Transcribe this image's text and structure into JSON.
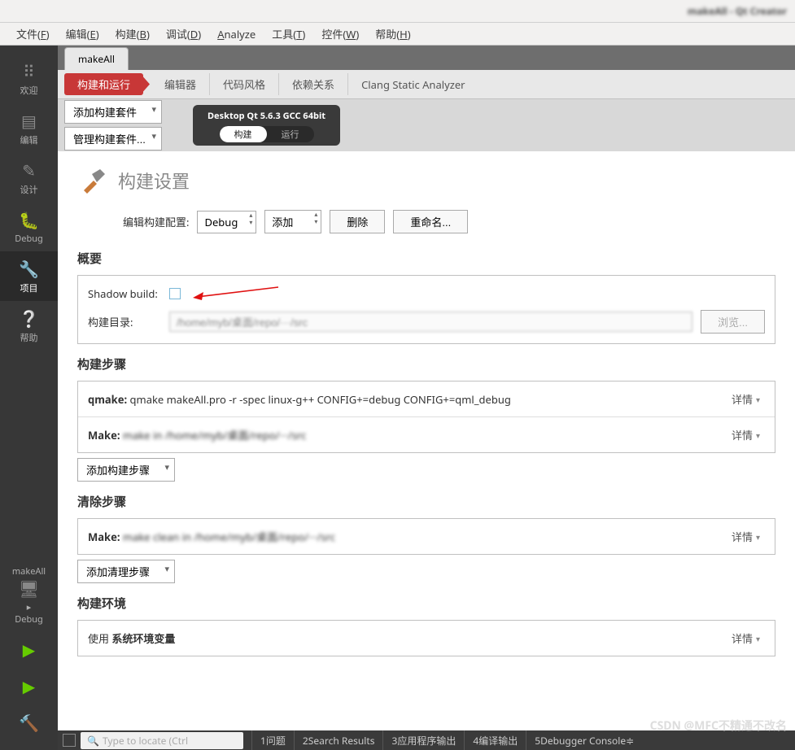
{
  "window_title": "makeAll - Qt Creator",
  "menu": {
    "file": "文件(F)",
    "edit": "编辑(E)",
    "build": "构建(B)",
    "debug": "调试(D)",
    "analyze": "Analyze",
    "tools": "工具(T)",
    "widgets": "控件(W)",
    "help": "帮助(H)"
  },
  "rail": {
    "welcome": "欢迎",
    "edit": "编辑",
    "design": "设计",
    "debug": "Debug",
    "projects": "项目",
    "help": "帮助",
    "project_name": "makeAll",
    "run_target": "Debug"
  },
  "tab": "makeAll",
  "subtabs": {
    "build_run": "构建和运行",
    "editor": "编辑器",
    "code_style": "代码风格",
    "dependencies": "依赖关系",
    "clang": "Clang Static Analyzer"
  },
  "kit": {
    "add_kit": "添加构建套件",
    "manage_kit": "管理构建套件...",
    "kit_name": "Desktop Qt 5.6.3 GCC 64bit",
    "build_tab": "构建",
    "run_tab": "运行"
  },
  "page": {
    "title": "构建设置",
    "edit_config_label": "编辑构建配置:",
    "config_value": "Debug",
    "add_btn": "添加",
    "delete_btn": "删除",
    "rename_btn": "重命名...",
    "overview": "概要",
    "shadow_build_label": "Shadow build:",
    "build_dir_label": "构建目录:",
    "build_dir_value": "/home/myb/桌面/repo/···/src",
    "browse_btn": "浏览...",
    "build_steps": "构建步骤",
    "qmake_label": "qmake:",
    "qmake_cmd": "qmake makeAll.pro -r -spec linux-g++ CONFIG+=debug CONFIG+=qml_debug",
    "make_label": "Make:",
    "make_cmd": "make in /home/myb/桌面/repo/···/src",
    "details": "详情",
    "add_build_step": "添加构建步骤",
    "clean_steps": "清除步骤",
    "clean_cmd": "make clean in /home/myb/桌面/repo/···/src",
    "add_clean_step": "添加清理步骤",
    "build_env": "构建环境",
    "use_env_prefix": "使用",
    "use_env_value": "系统环境变量"
  },
  "statusbar": {
    "search_placeholder": "Type to locate (Ctrl",
    "issues": "问题",
    "search_results": "Search Results",
    "app_output": "应用程序输出",
    "compile_output": "编译输出",
    "debug_console": "Debugger Console"
  },
  "watermark": "CSDN @MFC不精通不改名"
}
